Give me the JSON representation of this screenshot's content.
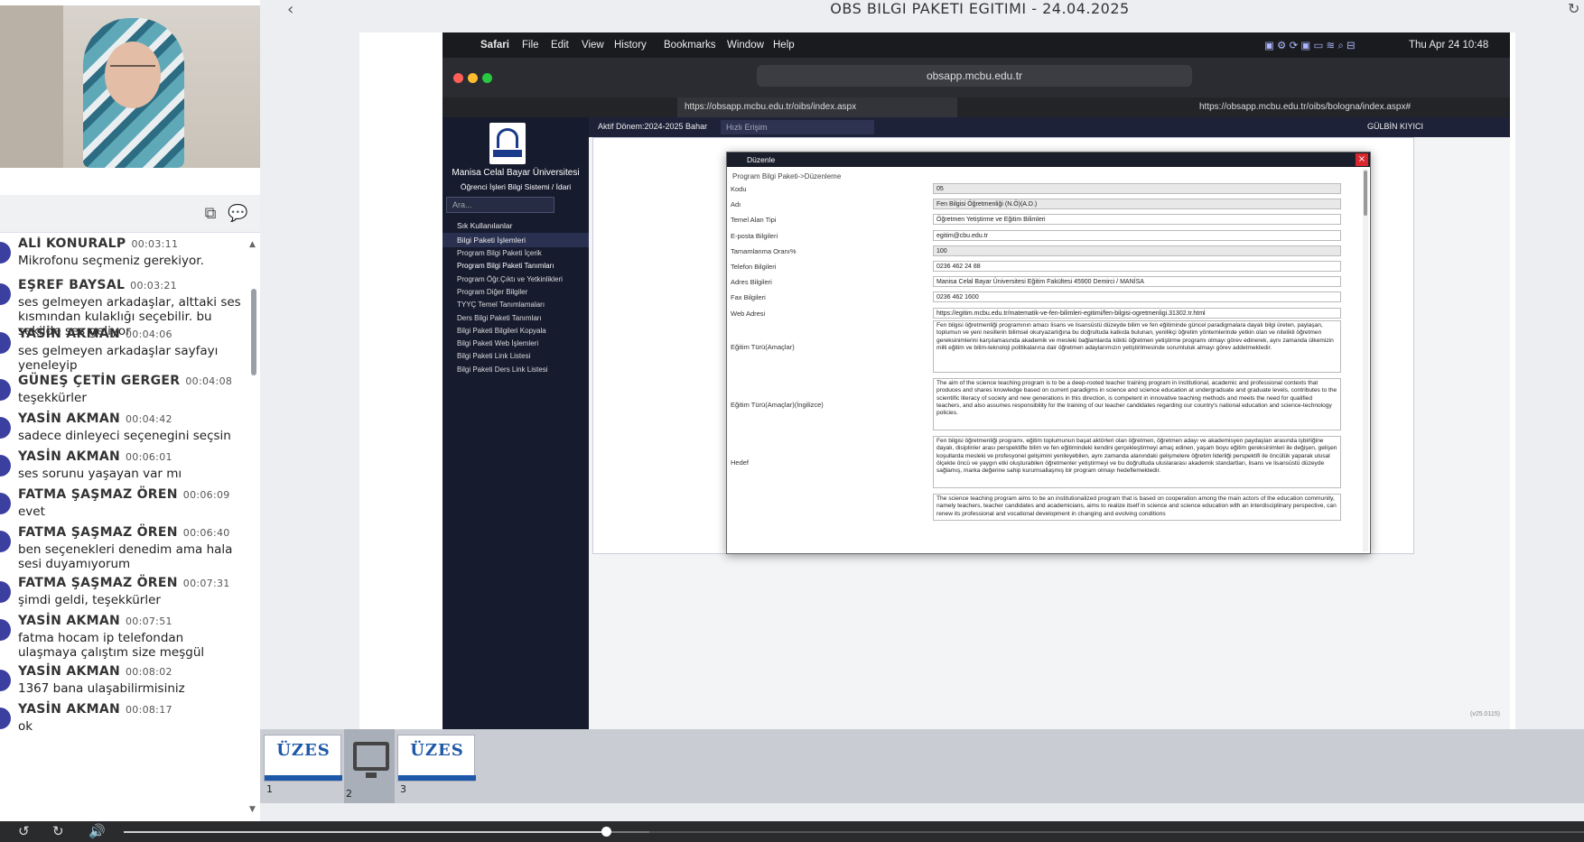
{
  "player": {
    "title": "OBS BILGI PAKETI EGITIMI - 24.04.2025",
    "progress_fraction": 0.33,
    "buffered_fraction": 0.36,
    "thumbnails": [
      {
        "num": "1",
        "logo": "ÜZES"
      },
      {
        "num": "2",
        "logo": ""
      },
      {
        "num": "3",
        "logo": "ÜZES"
      }
    ]
  },
  "chat": {
    "messages": [
      {
        "name": "ALİ KONURALP",
        "time": "00:03:11",
        "text": "Mikrofonu seçmeniz gerekiyor."
      },
      {
        "name": "EŞREF BAYSAL",
        "time": "00:03:21",
        "text": "ses gelmeyen arkadaşlar, alttaki ses kısmından kulaklığı seçebilir. bu sekilde ses geliyor"
      },
      {
        "name": "YASİN AKMAN",
        "time": "00:04:06",
        "text": "ses gelmeyen arkadaşlar sayfayı yeneleyip"
      },
      {
        "name": "GÜNEŞ ÇETİN GERGER",
        "time": "00:04:08",
        "text": "teşekkürler"
      },
      {
        "name": "YASİN AKMAN",
        "time": "00:04:42",
        "text": "sadece dinleyeci seçenegini seçsin"
      },
      {
        "name": "YASİN AKMAN",
        "time": "00:06:01",
        "text": "ses sorunu yaşayan var mı"
      },
      {
        "name": "FATMA ŞAŞMAZ ÖREN",
        "time": "00:06:09",
        "text": "evet"
      },
      {
        "name": "FATMA ŞAŞMAZ ÖREN",
        "time": "00:06:40",
        "text": "ben seçenekleri denedim ama hala sesi duyamıyorum"
      },
      {
        "name": "FATMA ŞAŞMAZ ÖREN",
        "time": "00:07:31",
        "text": "şimdi geldi, teşekkürler"
      },
      {
        "name": "YASİN AKMAN",
        "time": "00:07:51",
        "text": "fatma hocam ip telefondan ulaşmaya çalıştım size meşgül"
      },
      {
        "name": "YASİN AKMAN",
        "time": "00:08:02",
        "text": "1367 bana ulaşabilirmisiniz"
      },
      {
        "name": "YASİN AKMAN",
        "time": "00:08:17",
        "text": "ok"
      }
    ]
  },
  "mac": {
    "menu": [
      "Safari",
      "File",
      "Edit",
      "View",
      "History",
      "Bookmarks",
      "Window",
      "Help"
    ],
    "clock": "Thu Apr 24  10:48",
    "url": "obsapp.mcbu.edu.tr",
    "tab1": "https://obsapp.mcbu.edu.tr/oibs/index.aspx",
    "tab2": "https://obsapp.mcbu.edu.tr/oibs/bologna/index.aspx#"
  },
  "obs": {
    "university": "Manisa Celal Bayar Üniversitesi",
    "system": "Öğrenci İşleri Bilgi Sistemi / İdari",
    "search_placeholder": "Ara...",
    "fav": "Sık Kullanılanlar",
    "section": "Bilgi Paketi İşlemleri",
    "items": [
      "Program Bilgi Paketi İçerik",
      "Program Bilgi Paketi Tanımları",
      "Program Öğr.Çıktı ve Yetkinlikleri",
      "Program Diğer Bilgiler",
      "TYYÇ Temel Tanımlamaları",
      "Ders Bilgi Paketi Tanımları",
      "Bilgi Paketi Bilgileri Kopyala",
      "Bilgi Paketi Web İşlemleri",
      "Bilgi Paketi Link Listesi",
      "Bilgi Paketi Ders Link Listesi"
    ],
    "period": "Aktif Dönem:2024-2025 Bahar",
    "quick_access": "Hızlı Erişim",
    "user": "GÜLBİN KIYICI",
    "version": "(v25.0115)"
  },
  "modal": {
    "title": "Düzenle",
    "breadcrumb": "Program Bilgi Paketi->Düzenleme",
    "fields": [
      {
        "label": "Kodu",
        "value": "05"
      },
      {
        "label": "Adı",
        "value": "Fen Bilgisi Öğretmenliği (N.Ö)(A.D.)"
      },
      {
        "label": "Temel Alan Tipi",
        "value": "Öğretmen Yetiştirme ve Eğitim Bilimleri"
      },
      {
        "label": "E-posta Bilgileri",
        "value": "egitim@cbu.edu.tr"
      },
      {
        "label": "Tamamlanma Oranı%",
        "value": "100"
      },
      {
        "label": "Telefon Bilgileri",
        "value": "0236 462 24 88"
      },
      {
        "label": "Adres Bilgileri",
        "value": "Manisa Celal Bayar Üniversitesi Eğitim Fakültesi 45900 Demirci / MANİSA"
      },
      {
        "label": "Fax Bilgileri",
        "value": "0236 462 1600"
      },
      {
        "label": "Web Adresi",
        "value": "https://egitim.mcbu.edu.tr/matematik-ve-fen-bilimleri-egitimi/fen-bilgisi-ogretmenligi.31302.tr.html"
      }
    ],
    "long_fields": [
      {
        "label": "Eğitim Türü(Amaçlar)",
        "value": "Fen bilgisi öğretmenliği programının amacı lisans ve lisansüstü düzeyde bilim ve fen eğitiminde güncel paradigmalara dayalı bilgi üreten, paylaşan, toplumun ve yeni nesillerin bilimsel okuryazarlığına bu doğrultuda katkıda bulunan, yenilikçi öğretim yöntemlerinde yetkin olan ve nitelikli öğretmen gereksinimlerini karşılamasında akademik ve mesleki bağlamlarda köklü öğretmen yetiştirme programı olmayı görev edinerek, aynı zamanda ülkemizin milli eğitim ve bilim-teknoloji politikalarına dair öğretmen adaylarımızın yetiştirilmesinde sorumluluk almayı görev addetmektedir."
      },
      {
        "label": "Eğitim Türü(Amaçlar)(İngilizce)",
        "value": "The aim of the science teaching program is to be a deep-rooted teacher training program in institutional, academic and professional contexts that produces and shares knowledge based on current paradigms in science and science education at undergraduate and graduate levels, contributes to the scientific literacy of society and new generations in this direction, is competent in innovative teaching methods and meets the need for qualified teachers, and also assumes responsibility for the training of our teacher candidates regarding our country's national education and science-technology policies."
      },
      {
        "label": "Hedef",
        "value": "Fen bilgisi öğretmenliği programı, eğitim toplumunun başat aktörleri olan öğretmen, öğretmen adayı ve akademisyen paydaşları arasında işbirliğine dayalı, disiplinler arası perspektifle bilim ve fen eğitimindeki kendini gerçekleştirmeyi amaç edinen, yaşam boyu eğitim gereksinimleri ile değişen, gelişen koşullarda mesleki ve profesyonel gelişimini yenileyebilen, aynı zamanda alanındaki gelişmelere öğretim liderliği perspektifi ile öncülük yaparak ulusal ölçekte öncü ve yaygın etki oluşturabilen öğretmenler yetiştirmeyi ve bu doğrultuda uluslararası akademik standartları, lisans ve lisansüstü düzeyde sağlamış, marka değerine sahip kurumsallaşmış bir program olmayı hedeflemektedir."
      },
      {
        "label": "",
        "value": "The science teaching program aims to be an institutionalized program that is based on cooperation among the main actors of the education community, namely teachers, teacher candidates and academicians, aims to realize itself in science and science education with an interdisciplinary perspective, can renew its professional and vocational development in changing and evolving conditions"
      }
    ]
  }
}
